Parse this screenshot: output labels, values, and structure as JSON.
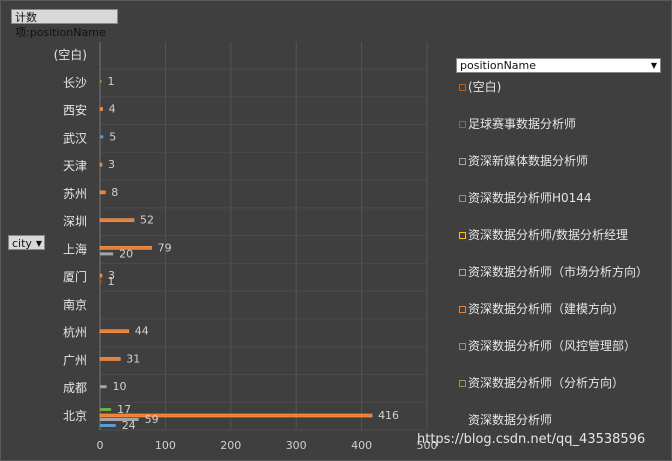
{
  "pivot": {
    "title_button": "计数项:positionName",
    "row_field": "city",
    "legend_field": "positionName",
    "watermark": "https://blog.csdn.net/qq_43538596"
  },
  "chart_data": {
    "type": "bar",
    "orientation": "horizontal",
    "title": "",
    "xlabel": "",
    "ylabel": "",
    "xlim": [
      0,
      500
    ],
    "xticks": [
      0,
      100,
      200,
      300,
      400,
      500
    ],
    "grid": true,
    "legend_position": "right",
    "categories": [
      "(空白)",
      "长沙",
      "西安",
      "武汉",
      "天津",
      "苏州",
      "深圳",
      "上海",
      "厦门",
      "南京",
      "杭州",
      "广州",
      "成都",
      "北京"
    ],
    "series": [
      {
        "name": "(空白)",
        "color": "#c55a11",
        "values": [
          null,
          null,
          null,
          null,
          null,
          null,
          null,
          null,
          null,
          null,
          null,
          null,
          null,
          null
        ]
      },
      {
        "name": "足球赛事数据分析师",
        "color": "#4472c4",
        "values": [
          null,
          null,
          null,
          null,
          null,
          null,
          null,
          null,
          null,
          null,
          null,
          null,
          null,
          null
        ]
      },
      {
        "name": "资深新媒体数据分析师",
        "color": "#a5a5a5",
        "values": [
          null,
          null,
          null,
          null,
          null,
          null,
          null,
          null,
          null,
          null,
          null,
          null,
          null,
          null
        ]
      },
      {
        "name": "资深数据分析师H0144",
        "color": "#5b9bd5",
        "values": [
          null,
          null,
          null,
          null,
          null,
          null,
          null,
          null,
          null,
          null,
          null,
          null,
          null,
          null
        ]
      },
      {
        "name": "资深数据分析师/数据分析经理",
        "color": "#ffc000",
        "values": [
          null,
          null,
          null,
          null,
          null,
          null,
          null,
          null,
          null,
          null,
          null,
          null,
          null,
          null
        ]
      },
      {
        "name": "资深数据分析师（市场分析方向）",
        "color": "#a5a5a5",
        "values": [
          null,
          null,
          null,
          null,
          null,
          null,
          null,
          null,
          null,
          null,
          null,
          null,
          null,
          null
        ]
      },
      {
        "name": "资深数据分析师（建模方向）",
        "color": "#ed7d31",
        "values": [
          null,
          null,
          null,
          null,
          null,
          null,
          null,
          null,
          null,
          null,
          null,
          null,
          null,
          null
        ]
      },
      {
        "name": "资深数据分析师（风控管理部）",
        "color": "#5b9bd5",
        "values": [
          null,
          null,
          null,
          null,
          null,
          null,
          null,
          null,
          null,
          null,
          null,
          null,
          null,
          null
        ]
      },
      {
        "name": "资深数据分析师（分析方向）",
        "color": "#70ad47",
        "values": [
          null,
          null,
          null,
          null,
          null,
          null,
          null,
          null,
          null,
          null,
          null,
          null,
          null,
          null
        ]
      },
      {
        "name": "资深数据分析师",
        "color": "#264478",
        "values": [
          null,
          null,
          null,
          null,
          null,
          null,
          null,
          null,
          null,
          null,
          null,
          null,
          null,
          null
        ]
      }
    ],
    "visible_bars": [
      {
        "category": "长沙",
        "value": 1,
        "label": "1",
        "color": "#70ad47"
      },
      {
        "category": "西安",
        "value": 4,
        "label": "4",
        "color": "#ed7d31"
      },
      {
        "category": "武汉",
        "value": 5,
        "label": "5",
        "color": "#5b9bd5"
      },
      {
        "category": "天津",
        "value": 3,
        "label": "3",
        "color": "#ed7d31"
      },
      {
        "category": "苏州",
        "value": 8,
        "label": "8",
        "color": "#ed7d31"
      },
      {
        "category": "深圳",
        "value": 52,
        "label": "52",
        "color": "#ed7d31"
      },
      {
        "category": "上海",
        "value": 79,
        "label": "79",
        "color": "#ed7d31"
      },
      {
        "category": "上海",
        "value": 20,
        "label": "20",
        "color": "#a5a5a5"
      },
      {
        "category": "厦门",
        "value": 3,
        "label": "3",
        "color": "#ed7d31"
      },
      {
        "category": "厦门",
        "value": 1,
        "label": "1",
        "color": "#c55a11"
      },
      {
        "category": "杭州",
        "value": 44,
        "label": "44",
        "color": "#ed7d31"
      },
      {
        "category": "广州",
        "value": 31,
        "label": "31",
        "color": "#ed7d31"
      },
      {
        "category": "成都",
        "value": 10,
        "label": "10",
        "color": "#a5a5a5"
      },
      {
        "category": "北京",
        "value": 17,
        "label": "17",
        "color": "#70ad47"
      },
      {
        "category": "北京",
        "value": 416,
        "label": "416",
        "color": "#ed7d31"
      },
      {
        "category": "北京",
        "value": 59,
        "label": "59",
        "color": "#a5a5a5"
      },
      {
        "category": "北京",
        "value": 24,
        "label": "24",
        "color": "#5b9bd5"
      }
    ]
  }
}
